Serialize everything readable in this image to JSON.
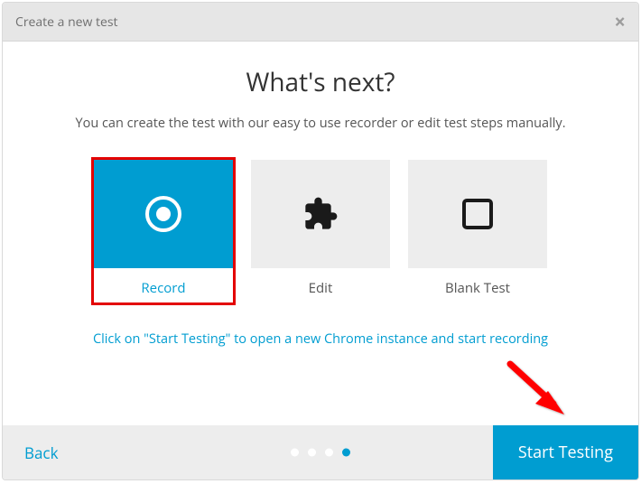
{
  "header": {
    "title": "Create a new test"
  },
  "main": {
    "heading": "What's next?",
    "subheading": "You can create the test with our easy to use recorder or edit test steps manually.",
    "options": [
      {
        "label": "Record"
      },
      {
        "label": "Edit"
      },
      {
        "label": "Blank Test"
      }
    ],
    "hint": "Click on \"Start Testing\" to open a new Chrome instance and start recording"
  },
  "footer": {
    "back_label": "Back",
    "start_label": "Start Testing",
    "steps_total": 4,
    "steps_active": 4
  },
  "colors": {
    "accent": "#009dd1",
    "highlight": "#e30000"
  }
}
